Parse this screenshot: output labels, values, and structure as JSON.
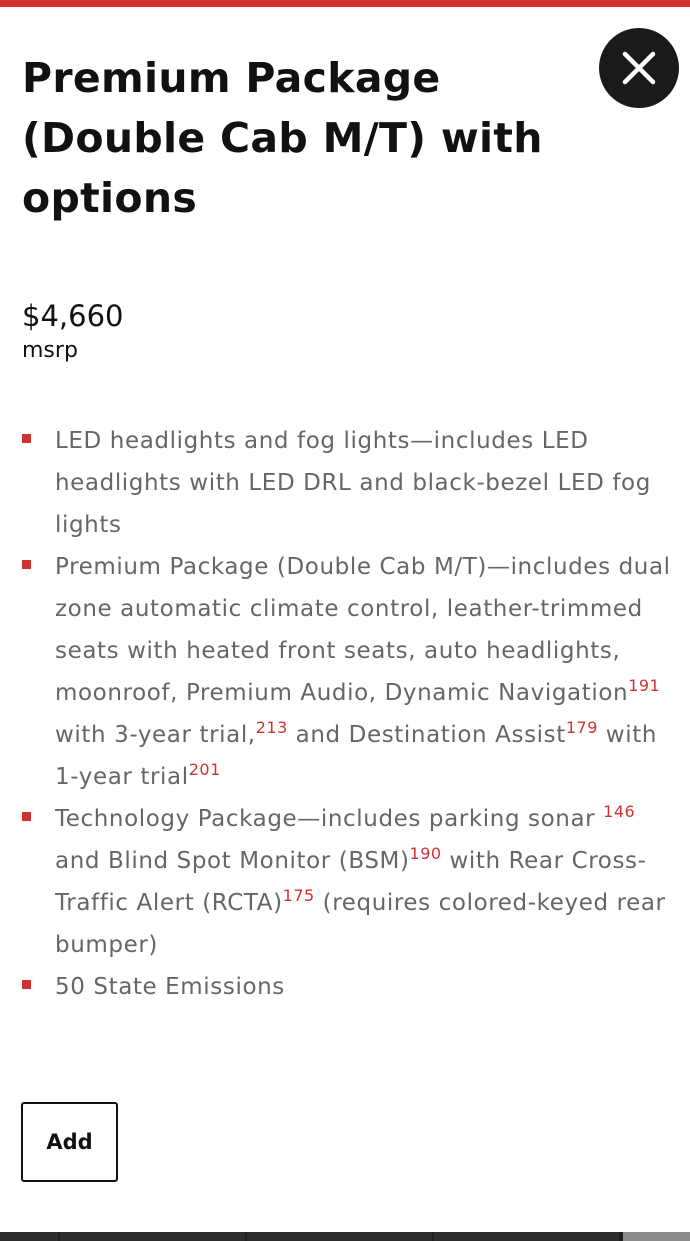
{
  "modal": {
    "title": "Premium Package (Double Cab M/T) with options",
    "price": "$4,660",
    "price_label": "msrp",
    "close_icon": "close-icon",
    "add_label": "Add"
  },
  "colors": {
    "accent": "#d0332f",
    "title_text": "#111111",
    "body_text": "#666666",
    "close_button_bg": "#1a1a1a"
  },
  "features": [
    {
      "segments": [
        {
          "text": "LED headlights and fog lights—includes LED headlights with LED DRL and black-bezel LED fog lights"
        }
      ]
    },
    {
      "segments": [
        {
          "text": "Premium Package (Double Cab M/T)—includes dual zone automatic climate control, leather-trimmed seats with heated front seats, auto headlights, moonroof, Premium Audio, Dynamic Navigation"
        },
        {
          "sup": "191"
        },
        {
          "text": " with 3-year trial,"
        },
        {
          "sup": "213"
        },
        {
          "text": " and Destination Assist"
        },
        {
          "sup": "179"
        },
        {
          "text": " with 1-year trial"
        },
        {
          "sup": "201"
        }
      ]
    },
    {
      "segments": [
        {
          "text": "Technology Package—includes parking sonar "
        },
        {
          "sup": "146"
        },
        {
          "text": " and Blind Spot Monitor (BSM)"
        },
        {
          "sup": "190"
        },
        {
          "text": " with Rear Cross-Traffic Alert (RCTA)"
        },
        {
          "sup": "175"
        },
        {
          "text": " (requires colored-keyed rear bumper)"
        }
      ]
    },
    {
      "segments": [
        {
          "text": "50 State Emissions"
        }
      ]
    }
  ]
}
